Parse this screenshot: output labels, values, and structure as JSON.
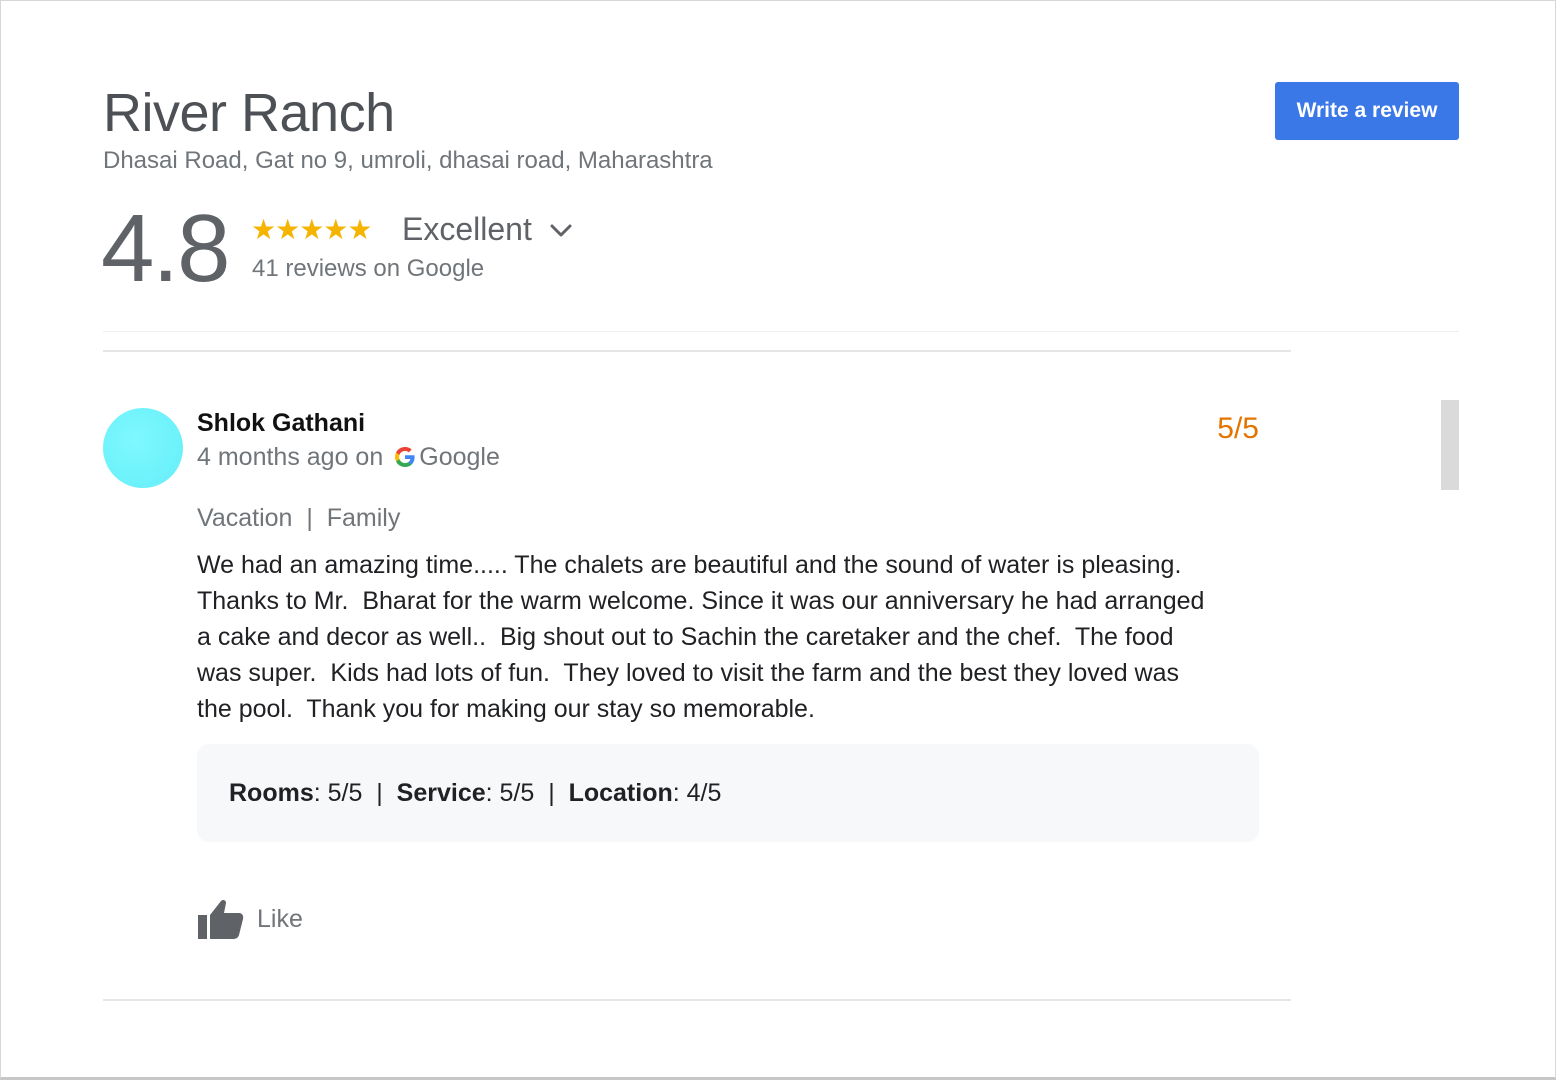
{
  "business": {
    "name": "River Ranch",
    "address": "Dhasai Road, Gat no 9, umroli, dhasai road, Maharashtra",
    "write_review_label": "Write a review",
    "rating": "4.8",
    "stars": "★★★★★",
    "rating_level": 4.8,
    "rating_label": "Excellent",
    "review_count_text": "41 reviews on Google"
  },
  "review": {
    "author": "Shlok Gathani",
    "time": "4 months ago on",
    "source": "Google",
    "score": "5/5",
    "tags": "Vacation  |  Family",
    "text": "We had an amazing time..... The chalets are beautiful and the sound of water is pleasing.\nThanks to Mr.  Bharat for the warm welcome. Since it was our anniversary he had arranged\na cake and decor as well..  Big shout out to Sachin the caretaker and the chef.  The food\nwas super.  Kids had lots of fun.  They loved to visit the farm and the best they loved was\nthe pool.  Thank you for making our stay so memorable.",
    "subratings": [
      {
        "label": "Rooms",
        "value": ": 5/5"
      },
      {
        "label": "Service",
        "value": ": 5/5"
      },
      {
        "label": "Location",
        "value": ": 4/5"
      }
    ],
    "separator": "  |  ",
    "like_label": "Like"
  },
  "colors": {
    "accent": "#3b78e7",
    "star": "#f4b400",
    "score": "#e37400",
    "avatar": "#6ef2fb"
  },
  "icons": {
    "expand": "chevron-down-icon",
    "source": "google-g-icon",
    "like": "thumbs-up-icon"
  }
}
